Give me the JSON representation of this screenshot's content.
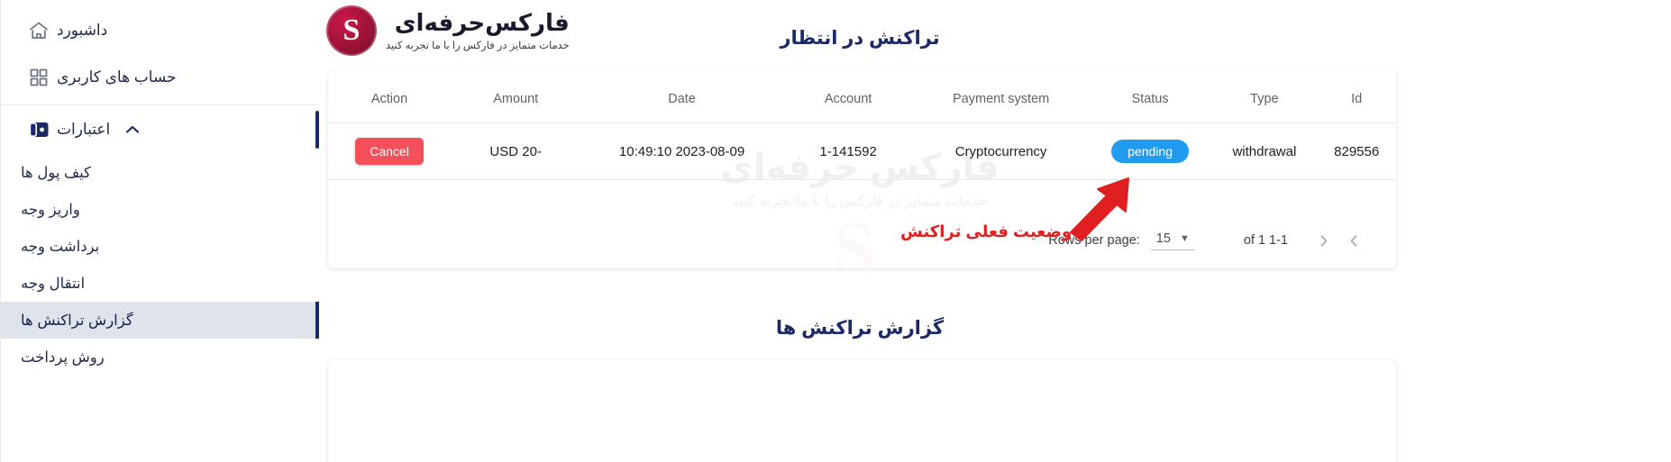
{
  "brand": {
    "title": "فارکس‌حرفه‌ای",
    "subtitle": "خدمات متمایز در فارکس را با ما تجربه کنید",
    "logo_letter": "S",
    "logo_color": "#9d1238"
  },
  "sidebar": {
    "items": [
      {
        "label": "داشبورد",
        "icon": "home-icon",
        "name": "dashboard"
      },
      {
        "label": "حساب های کاربری",
        "icon": "grid-icon",
        "name": "user-accounts"
      }
    ],
    "group": {
      "label": "اعتبارات",
      "icon": "wallet-icon",
      "chevron": "chevron-up-icon",
      "expanded": true,
      "active_color": "#1b2a66",
      "sub_items": [
        {
          "label": "کیف پول ها",
          "name": "wallets",
          "selected": false
        },
        {
          "label": "واریز وجه",
          "name": "deposit",
          "selected": false
        },
        {
          "label": "برداشت وجه",
          "name": "withdraw",
          "selected": false
        },
        {
          "label": "انتقال وجه",
          "name": "transfer",
          "selected": false
        },
        {
          "label": "گزارش تراکنش ها",
          "name": "transactions-report",
          "selected": true
        },
        {
          "label": "روش پرداخت",
          "name": "payment-method",
          "selected": false
        }
      ]
    }
  },
  "main": {
    "page_title": "تراکنش در انتظار",
    "section2_title": "گزارش تراکنش ها",
    "watermark": {
      "title": "فارکس حرفه‌ای",
      "subtitle": "خدمات متمایز در فارکس را با ما تجربه کنید",
      "mark": "S"
    },
    "table": {
      "columns": [
        "Action",
        "Amount",
        "Date",
        "Account",
        "Payment system",
        "Status",
        "Type",
        "Id"
      ],
      "rows": [
        {
          "action": "Cancel",
          "amount": "USD 20-",
          "date": "10:49:10 2023-08-09",
          "account": "1-141592",
          "payment_system": "Cryptocurrency",
          "status": "pending",
          "status_color": "#1f9bf0",
          "type": "withdrawal",
          "id": "829556"
        }
      ]
    },
    "pagination": {
      "prev_icon": "chevron-left-icon",
      "next_icon": "chevron-right-icon",
      "range": "of 1 1-1",
      "rows_per_page_value": "15",
      "rows_per_page_label": ":Rows per page",
      "caret_icon": "caret-down-icon"
    },
    "annotation": {
      "text": "وضعیت فعلی تراکنش",
      "color": "#e02020",
      "arrow_icon": "arrow-up-right-icon"
    }
  }
}
